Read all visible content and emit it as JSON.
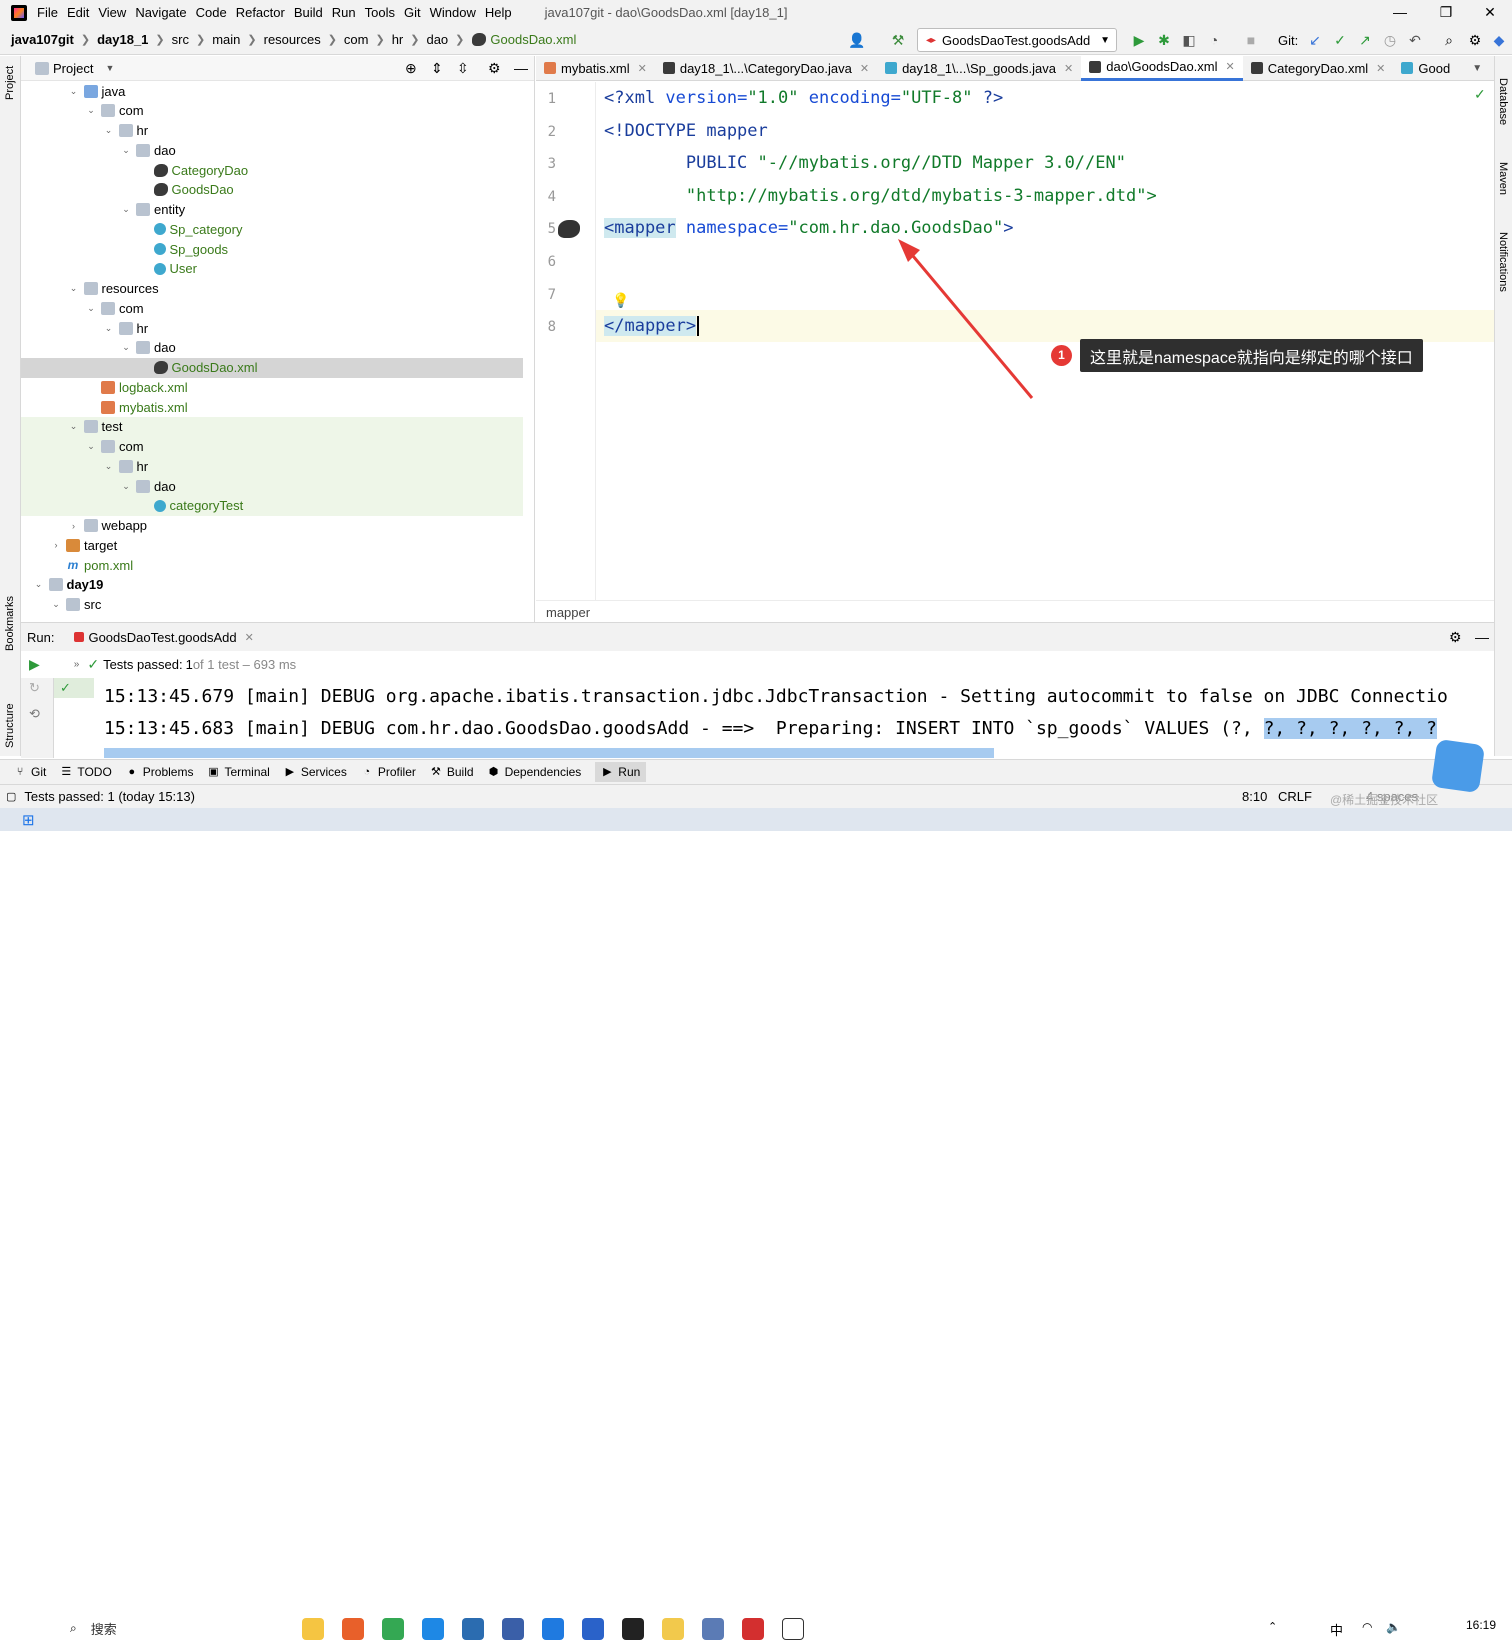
{
  "menu": {
    "items": [
      "File",
      "Edit",
      "View",
      "Navigate",
      "Code",
      "Refactor",
      "Build",
      "Run",
      "Tools",
      "Git",
      "Window",
      "Help"
    ],
    "window_title": "java107git - dao\\GoodsDao.xml [day18_1]",
    "minimize": "—",
    "maximize": "❐",
    "close": "✕"
  },
  "nav": {
    "crumbs": [
      "java107git",
      "day18_1",
      "src",
      "main",
      "resources",
      "com",
      "hr",
      "dao",
      "GoodsDao.xml"
    ],
    "run_config": "GoodsDaoTest.goodsAdd",
    "git_label": "Git:"
  },
  "leftstrip": {
    "project": "Project",
    "bookmarks": "Bookmarks",
    "structure": "Structure"
  },
  "project": {
    "header": "Project",
    "tree": [
      {
        "label": "java",
        "indent": 1,
        "arrow": "v",
        "icon": "folder-blue"
      },
      {
        "label": "com",
        "indent": 2,
        "arrow": "v",
        "icon": "folder"
      },
      {
        "label": "hr",
        "indent": 3,
        "arrow": "v",
        "icon": "folder"
      },
      {
        "label": "dao",
        "indent": 4,
        "arrow": "v",
        "icon": "folder"
      },
      {
        "label": "CategoryDao",
        "indent": 5,
        "arrow": "",
        "icon": "bird"
      },
      {
        "label": "GoodsDao",
        "indent": 5,
        "arrow": "",
        "icon": "bird"
      },
      {
        "label": "entity",
        "indent": 4,
        "arrow": "v",
        "icon": "folder"
      },
      {
        "label": "Sp_category",
        "indent": 5,
        "arrow": "",
        "icon": "cls"
      },
      {
        "label": "Sp_goods",
        "indent": 5,
        "arrow": "",
        "icon": "cls"
      },
      {
        "label": "User",
        "indent": 5,
        "arrow": "",
        "icon": "cls"
      },
      {
        "label": "resources",
        "indent": 1,
        "arrow": "v",
        "icon": "folder"
      },
      {
        "label": "com",
        "indent": 2,
        "arrow": "v",
        "icon": "folder"
      },
      {
        "label": "hr",
        "indent": 3,
        "arrow": "v",
        "icon": "folder"
      },
      {
        "label": "dao",
        "indent": 4,
        "arrow": "v",
        "icon": "folder"
      },
      {
        "label": "GoodsDao.xml",
        "indent": 5,
        "arrow": "",
        "icon": "bird",
        "selected": true
      },
      {
        "label": "logback.xml",
        "indent": 2,
        "arrow": "",
        "icon": "xml"
      },
      {
        "label": "mybatis.xml",
        "indent": 2,
        "arrow": "",
        "icon": "xml"
      },
      {
        "label": "test",
        "indent": 1,
        "arrow": "v",
        "icon": "folder"
      },
      {
        "label": "com",
        "indent": 2,
        "arrow": "v",
        "icon": "folder"
      },
      {
        "label": "hr",
        "indent": 3,
        "arrow": "v",
        "icon": "folder"
      },
      {
        "label": "dao",
        "indent": 4,
        "arrow": "v",
        "icon": "folder"
      },
      {
        "label": "categoryTest",
        "indent": 5,
        "arrow": "",
        "icon": "cls"
      },
      {
        "label": "webapp",
        "indent": 1,
        "arrow": ">",
        "icon": "folder"
      },
      {
        "label": "target",
        "indent": 0,
        "arrow": ">",
        "icon": "folder-orange"
      },
      {
        "label": "pom.xml",
        "indent": 0,
        "arrow": "",
        "icon": "mvn"
      },
      {
        "label": "day19",
        "indent": -1,
        "arrow": "v",
        "icon": "folder",
        "bold": true
      },
      {
        "label": "src",
        "indent": 0,
        "arrow": "v",
        "icon": "folder"
      }
    ]
  },
  "tabs": [
    {
      "label": "mybatis.xml",
      "active": false
    },
    {
      "label": "day18_1\\...\\CategoryDao.java",
      "active": false
    },
    {
      "label": "day18_1\\...\\Sp_goods.java",
      "active": false
    },
    {
      "label": "dao\\GoodsDao.xml",
      "active": true
    },
    {
      "label": "CategoryDao.xml",
      "active": false
    },
    {
      "label": "Good",
      "active": false
    }
  ],
  "editor": {
    "line_numbers": [
      "1",
      "2",
      "3",
      "4",
      "5",
      "6",
      "7",
      "8"
    ],
    "l1_a": "<?xml ",
    "l1_b": "version=",
    "l1_c": "\"1.0\"",
    "l1_d": " encoding=",
    "l1_e": "\"UTF-8\"",
    "l1_f": " ?>",
    "l2": "<!DOCTYPE mapper",
    "l3_a": "        PUBLIC ",
    "l3_b": "\"-//mybatis.org//DTD Mapper 3.0//EN\"",
    "l4": "        \"http://mybatis.org/dtd/mybatis-3-mapper.dtd\">",
    "l5_a": "<mapper",
    "l5_b": " namespace=",
    "l5_c": "\"com.hr.dao.GoodsDao\"",
    "l5_d": ">",
    "l8": "</mapper>",
    "breadcrumb": "mapper"
  },
  "callout": {
    "number": "1",
    "text": "这里就是namespace就指向是绑定的哪个接口"
  },
  "rightstrip": {
    "database": "Database",
    "maven": "Maven",
    "notifications": "Notifications"
  },
  "run": {
    "label": "Run:",
    "config": "GoodsDaoTest.goodsAdd",
    "status_a": "Tests passed: ",
    "status_b": "1",
    "status_c": " of 1 test – 693 ms",
    "console_1": "15:13:45.679 [main] DEBUG org.apache.ibatis.transaction.jdbc.JdbcTransaction - Setting autocommit to false on JDBC Connectio",
    "console_2a": "15:13:45.683 [main] DEBUG com.hr.dao.GoodsDao.goodsAdd - ==>  Preparing: INSERT INTO `sp_goods` VALUES (?, ",
    "console_2b": "?, ?, ?, ?, ?, ?"
  },
  "toolwindows": [
    "Git",
    "TODO",
    "Problems",
    "Terminal",
    "Services",
    "Profiler",
    "Build",
    "Dependencies",
    "Run"
  ],
  "status": {
    "left": "Tests passed: 1 (today 15:13)",
    "position": "8:10",
    "line_sep": "CRLF",
    "indent": "4 spaces",
    "watermark": "@稀土掘金技术社区"
  },
  "taskbar": {
    "search": "搜索",
    "ime": "中",
    "time": "16:19"
  }
}
